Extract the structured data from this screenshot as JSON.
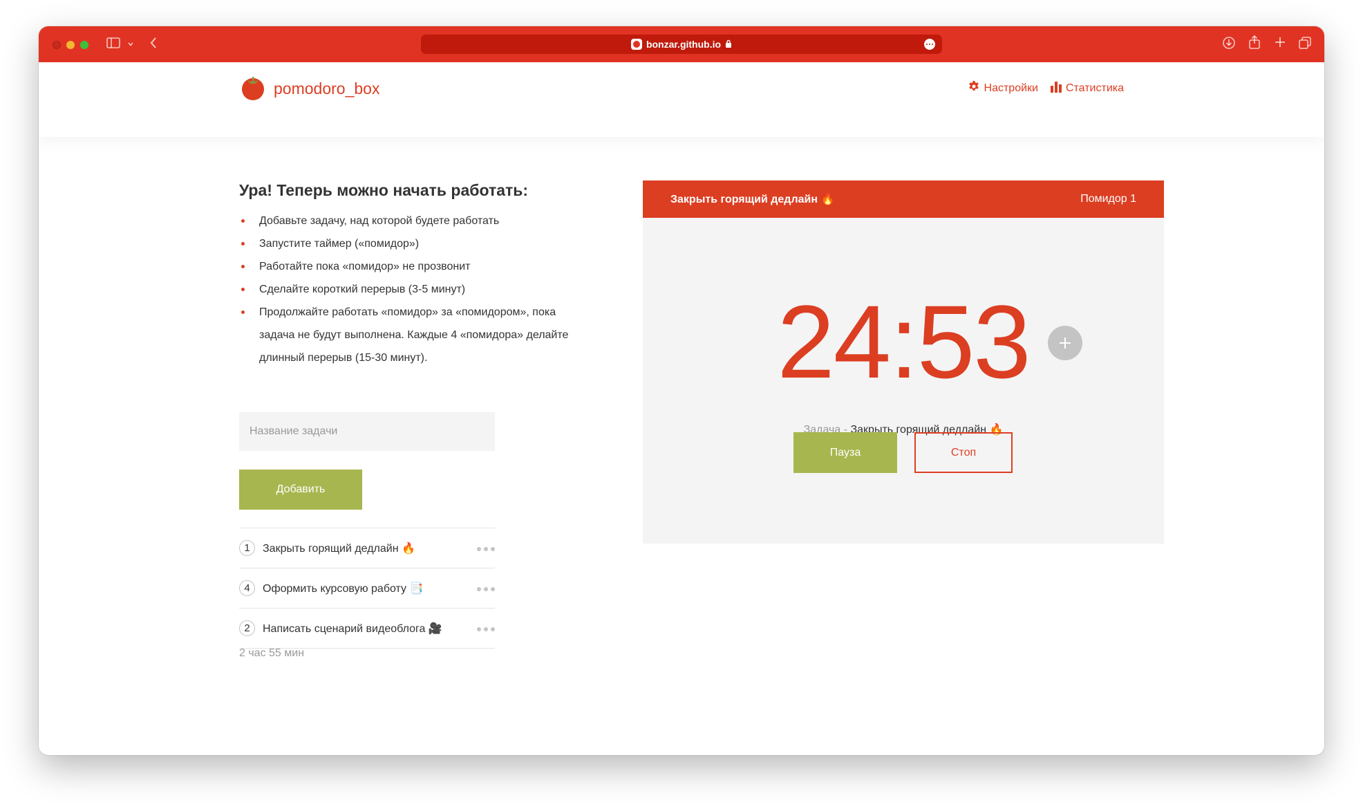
{
  "browser": {
    "url": "bonzar.github.io",
    "colors": {
      "toolbar": "#e13323",
      "urlbar": "#bf1a0c"
    }
  },
  "header": {
    "logo_text": "pomodoro_box",
    "nav": [
      {
        "label": "Настройки",
        "icon": "gear-icon"
      },
      {
        "label": "Статистика",
        "icon": "bar-chart-icon"
      }
    ]
  },
  "intro": {
    "headline": "Ура! Теперь можно начать работать:",
    "steps": [
      "Добавьте задачу, над которой будете работать",
      "Запустите таймер («помидор»)",
      "Работайте пока «помидор» не прозвонит",
      "Сделайте короткий перерыв (3-5 минут)",
      "Продолжайте работать «помидор» за «помидором», пока задача не будут выполнена. Каждые 4 «помидора» делайте длинный перерыв (15-30 минут)."
    ]
  },
  "task_form": {
    "placeholder": "Название задачи",
    "add_label": "Добавить"
  },
  "tasks": [
    {
      "count": "1",
      "name": "Закрыть горящий дедлайн 🔥"
    },
    {
      "count": "4",
      "name": "Оформить курсовую работу 📑"
    },
    {
      "count": "2",
      "name": "Написать сценарий видеоблога 🎥"
    }
  ],
  "total_time": "2 час 55 мин",
  "timer": {
    "task_title": "Закрыть горящий дедлайн 🔥",
    "pomodoro_label": "Помидор 1",
    "time": "24:53",
    "task_prefix": "Задача - ",
    "task_name": "Закрыть горящий дедлайн 🔥",
    "pause_label": "Пауза",
    "stop_label": "Стоп"
  },
  "colors": {
    "accent": "#dc3e22",
    "green": "#a8b64f",
    "panel": "#f4f4f4"
  }
}
